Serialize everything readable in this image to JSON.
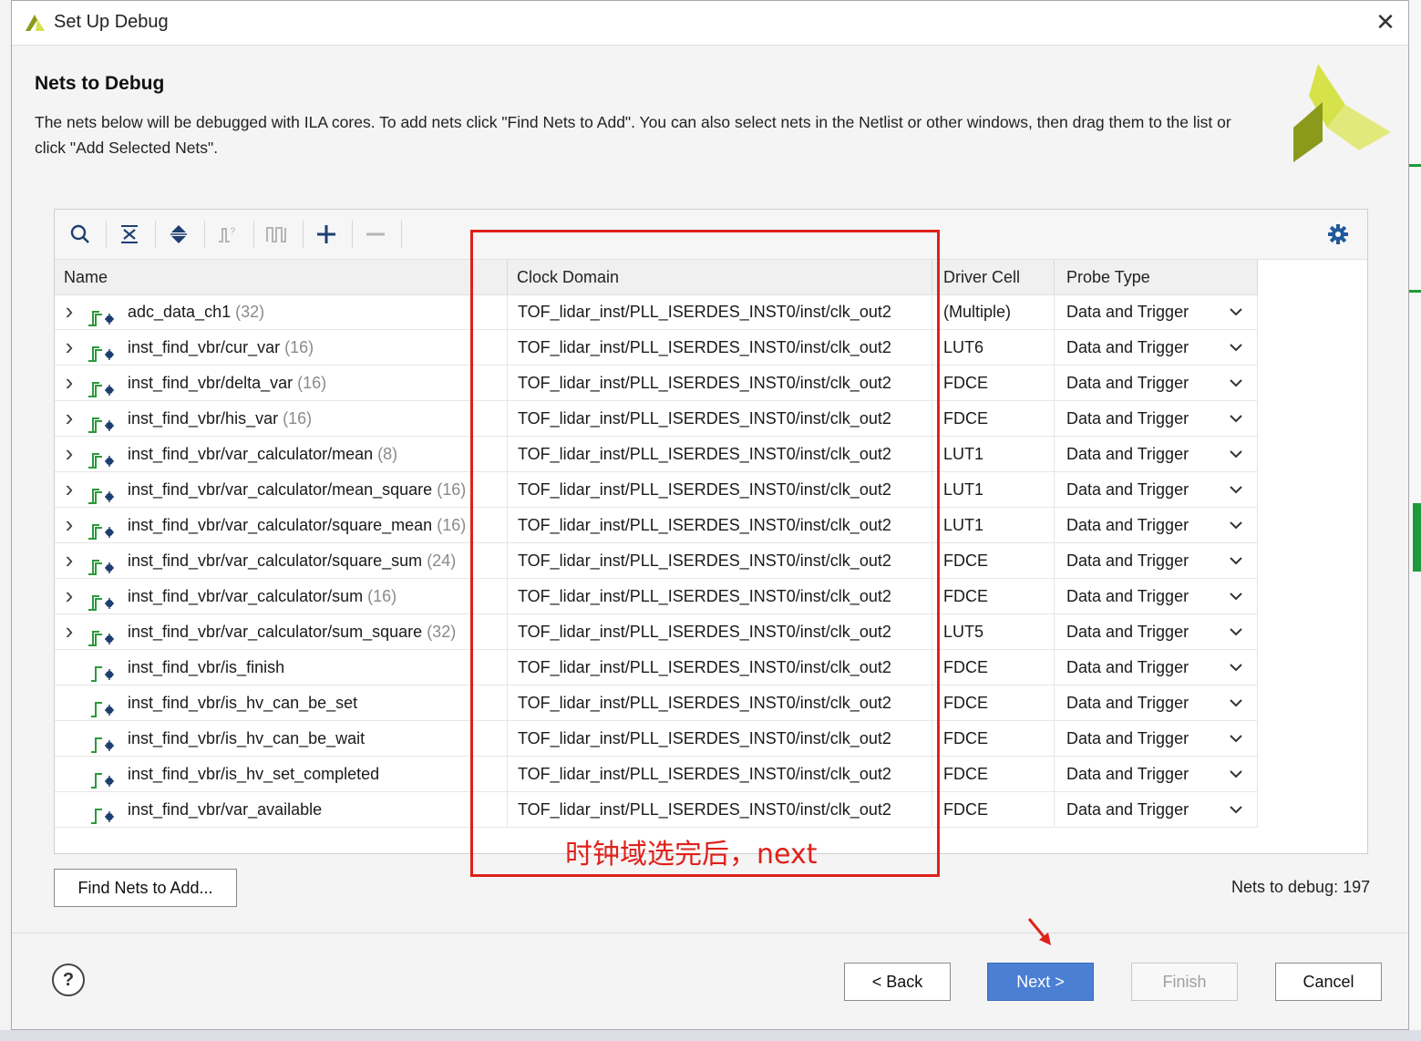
{
  "window": {
    "title": "Set Up Debug",
    "close_glyph": "✕"
  },
  "header": {
    "heading": "Nets to Debug",
    "description": "The nets below will be debugged with ILA cores. To add nets click \"Find Nets to Add\". You can also select nets in the Netlist or other windows, then drag them to the list or click \"Add Selected Nets\"."
  },
  "toolbar": {
    "icons": [
      "search-icon",
      "collapse-all-icon",
      "expand-all-icon",
      "select-clock-domain-icon",
      "select-probe-type-icon",
      "add-icon",
      "remove-icon",
      "settings-gear-icon"
    ]
  },
  "columns": [
    "Name",
    "Clock Domain",
    "Driver Cell",
    "Probe Type"
  ],
  "rows": [
    {
      "name": "adc_data_ch1",
      "count": "(32)",
      "bus": true,
      "clock": "TOF_lidar_inst/PLL_ISERDES_INST0/inst/clk_out2",
      "driver": "(Multiple)",
      "probe": "Data and Trigger"
    },
    {
      "name": "inst_find_vbr/cur_var",
      "count": "(16)",
      "bus": true,
      "clock": "TOF_lidar_inst/PLL_ISERDES_INST0/inst/clk_out2",
      "driver": "LUT6",
      "probe": "Data and Trigger"
    },
    {
      "name": "inst_find_vbr/delta_var",
      "count": "(16)",
      "bus": true,
      "clock": "TOF_lidar_inst/PLL_ISERDES_INST0/inst/clk_out2",
      "driver": "FDCE",
      "probe": "Data and Trigger"
    },
    {
      "name": "inst_find_vbr/his_var",
      "count": "(16)",
      "bus": true,
      "clock": "TOF_lidar_inst/PLL_ISERDES_INST0/inst/clk_out2",
      "driver": "FDCE",
      "probe": "Data and Trigger"
    },
    {
      "name": "inst_find_vbr/var_calculator/mean",
      "count": "(8)",
      "bus": true,
      "clock": "TOF_lidar_inst/PLL_ISERDES_INST0/inst/clk_out2",
      "driver": "LUT1",
      "probe": "Data and Trigger"
    },
    {
      "name": "inst_find_vbr/var_calculator/mean_square",
      "count": "(16)",
      "bus": true,
      "clock": "TOF_lidar_inst/PLL_ISERDES_INST0/inst/clk_out2",
      "driver": "LUT1",
      "probe": "Data and Trigger"
    },
    {
      "name": "inst_find_vbr/var_calculator/square_mean",
      "count": "(16)",
      "bus": true,
      "clock": "TOF_lidar_inst/PLL_ISERDES_INST0/inst/clk_out2",
      "driver": "LUT1",
      "probe": "Data and Trigger"
    },
    {
      "name": "inst_find_vbr/var_calculator/square_sum",
      "count": "(24)",
      "bus": true,
      "clock": "TOF_lidar_inst/PLL_ISERDES_INST0/inst/clk_out2",
      "driver": "FDCE",
      "probe": "Data and Trigger"
    },
    {
      "name": "inst_find_vbr/var_calculator/sum",
      "count": "(16)",
      "bus": true,
      "clock": "TOF_lidar_inst/PLL_ISERDES_INST0/inst/clk_out2",
      "driver": "FDCE",
      "probe": "Data and Trigger"
    },
    {
      "name": "inst_find_vbr/var_calculator/sum_square",
      "count": "(32)",
      "bus": true,
      "clock": "TOF_lidar_inst/PLL_ISERDES_INST0/inst/clk_out2",
      "driver": "LUT5",
      "probe": "Data and Trigger"
    },
    {
      "name": "inst_find_vbr/is_finish",
      "count": "",
      "bus": false,
      "clock": "TOF_lidar_inst/PLL_ISERDES_INST0/inst/clk_out2",
      "driver": "FDCE",
      "probe": "Data and Trigger"
    },
    {
      "name": "inst_find_vbr/is_hv_can_be_set",
      "count": "",
      "bus": false,
      "clock": "TOF_lidar_inst/PLL_ISERDES_INST0/inst/clk_out2",
      "driver": "FDCE",
      "probe": "Data and Trigger"
    },
    {
      "name": "inst_find_vbr/is_hv_can_be_wait",
      "count": "",
      "bus": false,
      "clock": "TOF_lidar_inst/PLL_ISERDES_INST0/inst/clk_out2",
      "driver": "FDCE",
      "probe": "Data and Trigger"
    },
    {
      "name": "inst_find_vbr/is_hv_set_completed",
      "count": "",
      "bus": false,
      "clock": "TOF_lidar_inst/PLL_ISERDES_INST0/inst/clk_out2",
      "driver": "FDCE",
      "probe": "Data and Trigger"
    },
    {
      "name": "inst_find_vbr/var_available",
      "count": "",
      "bus": false,
      "clock": "TOF_lidar_inst/PLL_ISERDES_INST0/inst/clk_out2",
      "driver": "FDCE",
      "probe": "Data and Trigger"
    }
  ],
  "annotation": {
    "text": "时钟域选完后，next",
    "color": "#e0201a"
  },
  "find_nets_button": "Find Nets to Add...",
  "nets_to_debug": "Nets to debug: 197",
  "footer": {
    "help": "?",
    "back": "< Back",
    "next": "Next >",
    "finish": "Finish",
    "cancel": "Cancel"
  },
  "colors": {
    "accent": "#4a7fd4",
    "net_icon": "#2a9a3a",
    "logo_light": "#d6e24a",
    "logo_dark": "#8c9a1c"
  }
}
